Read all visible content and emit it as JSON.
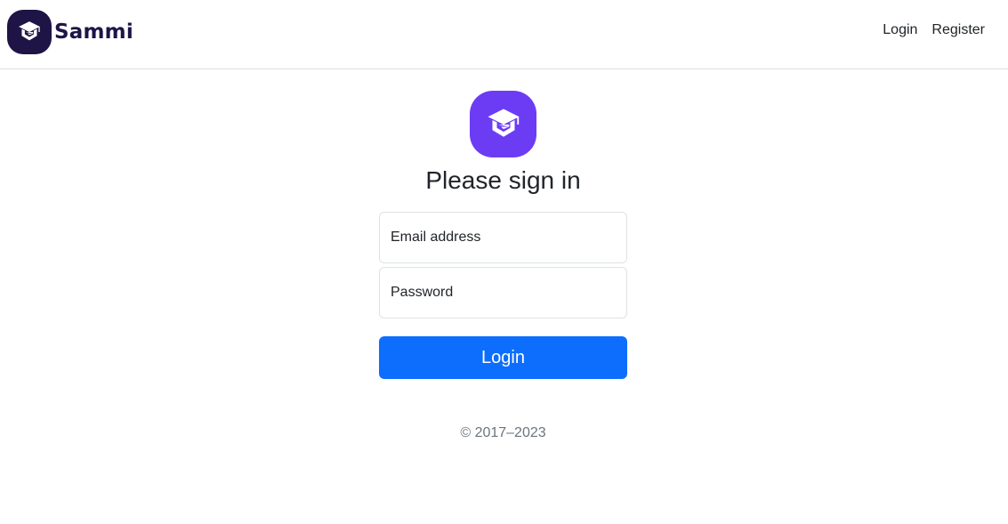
{
  "brand": {
    "name": "Sammi",
    "logo_icon": "graduation-cap-icon",
    "logo_bg": "#1e1446"
  },
  "nav": {
    "links": [
      "Login",
      "Register"
    ]
  },
  "signin": {
    "logo_icon": "graduation-cap-icon",
    "logo_bg": "#6c3cf5",
    "heading": "Please sign in",
    "email_placeholder": "Email address",
    "password_placeholder": "Password",
    "submit_label": "Login",
    "submit_color": "#0d6efd"
  },
  "footer": {
    "copyright": "© 2017–2023"
  }
}
